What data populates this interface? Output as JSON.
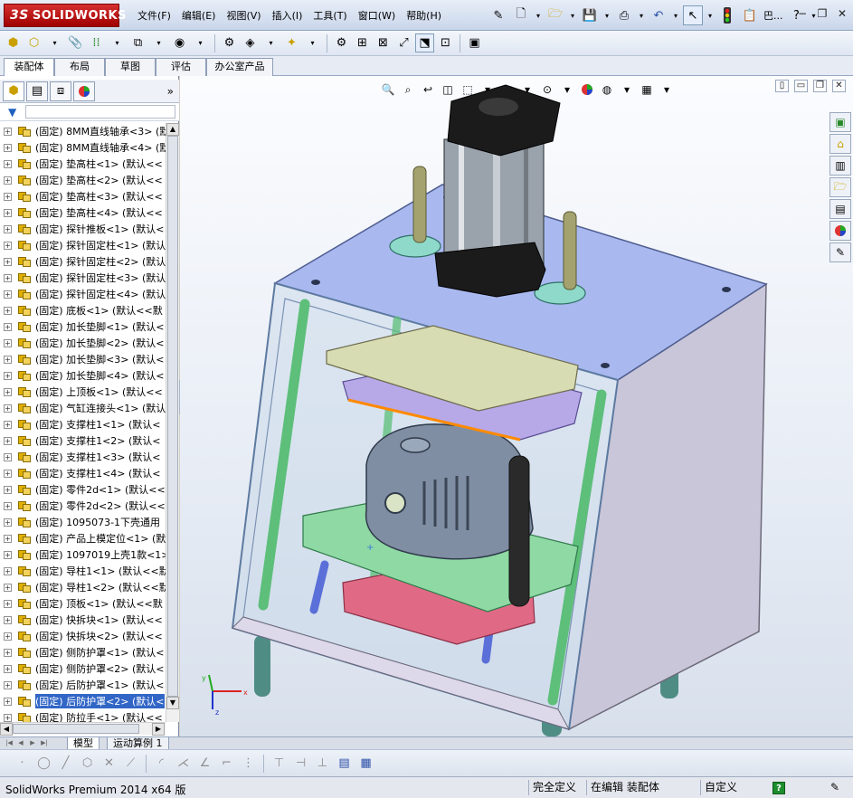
{
  "app": {
    "logo_text": "SOLIDWORKS",
    "logo_prefix": "3S"
  },
  "menu": [
    {
      "label": "文件(F)"
    },
    {
      "label": "编辑(E)"
    },
    {
      "label": "视图(V)"
    },
    {
      "label": "插入(I)"
    },
    {
      "label": "工具(T)"
    },
    {
      "label": "窗口(W)"
    },
    {
      "label": "帮助(H)"
    }
  ],
  "title_toolbar": {
    "icons": [
      "pin-icon",
      "new-document-icon",
      "open-folder-icon",
      "save-icon",
      "print-icon",
      "undo-icon",
      "select-arrow-icon",
      "rebuild-traffic-light-icon",
      "options-icon",
      "help-icon"
    ],
    "extra_label": "巴..."
  },
  "command_manager_tabs": [
    {
      "label": "装配体",
      "active": true
    },
    {
      "label": "布局",
      "active": false
    },
    {
      "label": "草图",
      "active": false
    },
    {
      "label": "评估",
      "active": false
    },
    {
      "label": "办公室产品",
      "active": false
    }
  ],
  "feature_tree": {
    "items": [
      {
        "label": "(固定) 8MM直线轴承<3> (默"
      },
      {
        "label": "(固定) 8MM直线轴承<4> (默"
      },
      {
        "label": "(固定) 垫高柱<1> (默认<<"
      },
      {
        "label": "(固定) 垫高柱<2> (默认<<"
      },
      {
        "label": "(固定) 垫高柱<3> (默认<<"
      },
      {
        "label": "(固定) 垫高柱<4> (默认<<"
      },
      {
        "label": "(固定) 探针推板<1> (默认<"
      },
      {
        "label": "(固定) 探针固定柱<1> (默认"
      },
      {
        "label": "(固定) 探针固定柱<2> (默认"
      },
      {
        "label": "(固定) 探针固定柱<3> (默认"
      },
      {
        "label": "(固定) 探针固定柱<4> (默认"
      },
      {
        "label": "(固定) 底板<1> (默认<<默"
      },
      {
        "label": "(固定) 加长垫脚<1> (默认<"
      },
      {
        "label": "(固定) 加长垫脚<2> (默认<"
      },
      {
        "label": "(固定) 加长垫脚<3> (默认<"
      },
      {
        "label": "(固定) 加长垫脚<4> (默认<"
      },
      {
        "label": "(固定) 上顶板<1> (默认<<"
      },
      {
        "label": "(固定) 气缸连接头<1> (默认"
      },
      {
        "label": "(固定) 支撑柱1<1> (默认<"
      },
      {
        "label": "(固定) 支撑柱1<2> (默认<"
      },
      {
        "label": "(固定) 支撑柱1<3> (默认<"
      },
      {
        "label": "(固定) 支撑柱1<4> (默认<"
      },
      {
        "label": "(固定) 零件2d<1> (默认<<"
      },
      {
        "label": "(固定) 零件2d<2> (默认<<"
      },
      {
        "label": "(固定) 1095073-1下壳通用"
      },
      {
        "label": "(固定) 产品上模定位<1> (默"
      },
      {
        "label": "(固定) 1097019上壳1款<1>"
      },
      {
        "label": "(固定) 导柱1<1> (默认<<默"
      },
      {
        "label": "(固定) 导柱1<2> (默认<<默"
      },
      {
        "label": "(固定) 顶板<1> (默认<<默"
      },
      {
        "label": "(固定) 快拆块<1> (默认<<"
      },
      {
        "label": "(固定) 快拆块<2> (默认<<"
      },
      {
        "label": "(固定) 侧防护罩<1> (默认<"
      },
      {
        "label": "(固定) 侧防护罩<2> (默认<"
      },
      {
        "label": "(固定) 后防护罩<1> (默认<"
      },
      {
        "label": "(固定) 后防护罩<2> (默认<",
        "selected": true
      },
      {
        "label": "(固定) 防拉手<1> (默认<<"
      }
    ]
  },
  "bottom_tabs": [
    {
      "label": "模型",
      "active": true
    },
    {
      "label": "运动算例 1",
      "active": false
    }
  ],
  "status": {
    "product": "SolidWorks Premium 2014 x64 版",
    "definition": "完全定义",
    "editing": "在编辑 装配体",
    "units": "自定义",
    "help": "?"
  },
  "colors": {
    "top_plate": "#a9b9f0",
    "side_panel": "#c9c6d9",
    "green_plate": "#8ed9a4",
    "pillar_green": "#5dbf7a",
    "pink_base": "#e06a86",
    "cylinder_body": "#9aa2ab",
    "product_gray": "#7f8ea3"
  }
}
